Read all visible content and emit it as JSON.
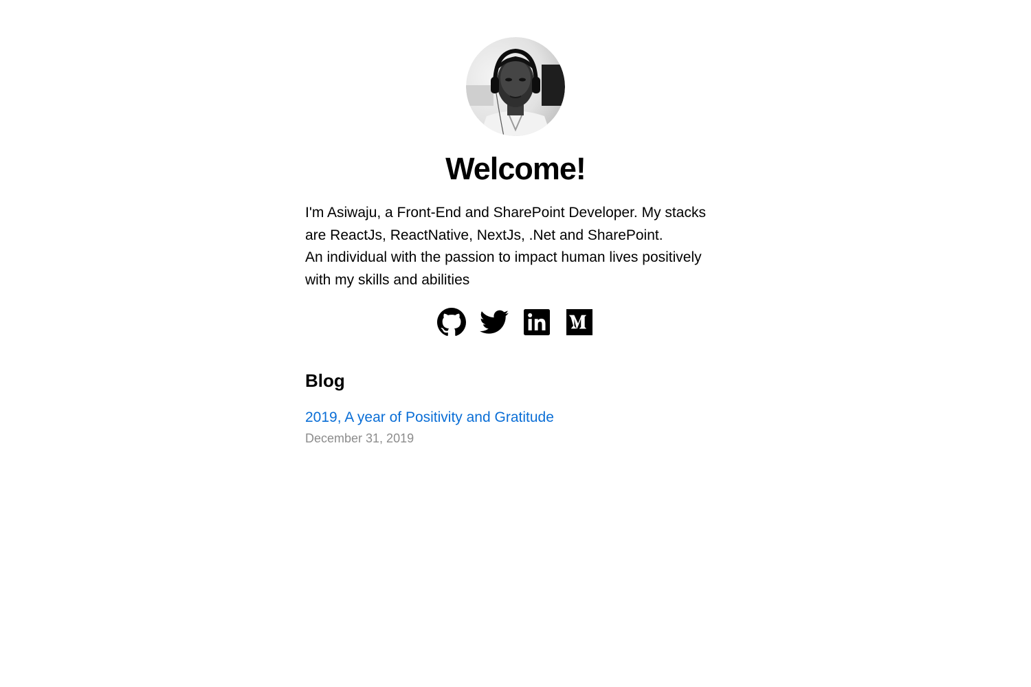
{
  "header": {
    "title": "Welcome!"
  },
  "bio": {
    "paragraphs": [
      "I'm Asiwaju, a Front-End and SharePoint Developer. My stacks are ReactJs, ReactNative, NextJs, .Net and SharePoint.",
      "An individual with the passion to impact human lives positively with my skills and abilities"
    ]
  },
  "socials": [
    {
      "icon": "github-icon"
    },
    {
      "icon": "twitter-icon"
    },
    {
      "icon": "linkedin-icon"
    },
    {
      "icon": "medium-icon"
    }
  ],
  "blog": {
    "heading": "Blog",
    "posts": [
      {
        "title": "2019, A year of Positivity and Gratitude",
        "date": "December 31, 2019"
      }
    ]
  },
  "colors": {
    "link": "#0a6ed6",
    "date": "#8c8c8c",
    "text": "#000000"
  }
}
